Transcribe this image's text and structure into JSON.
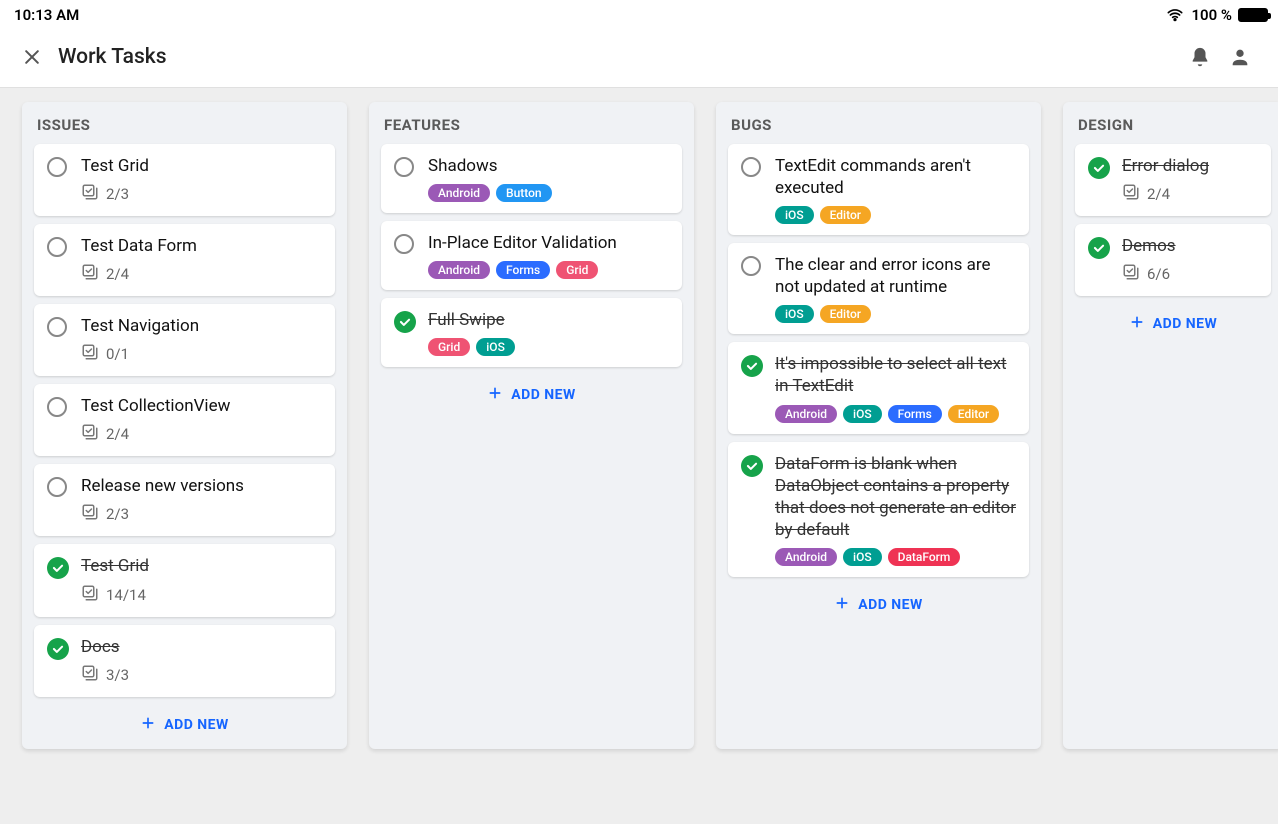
{
  "status": {
    "time": "10:13 AM",
    "battery": "100 %"
  },
  "header": {
    "title": "Work Tasks"
  },
  "ui": {
    "add_new": "ADD NEW"
  },
  "tag_classes": {
    "Android": "t-android",
    "Button": "t-button",
    "Forms": "t-forms",
    "Grid": "t-grid",
    "iOS": "t-ios",
    "Editor": "t-editor",
    "DataForm": "t-dataform"
  },
  "columns": [
    {
      "title": "Issues",
      "cards": [
        {
          "title": "Test Grid",
          "done": false,
          "subtasks": "2/3"
        },
        {
          "title": "Test Data Form",
          "done": false,
          "subtasks": "2/4"
        },
        {
          "title": "Test Navigation",
          "done": false,
          "subtasks": "0/1"
        },
        {
          "title": "Test CollectionView",
          "done": false,
          "subtasks": "2/4"
        },
        {
          "title": "Release new versions",
          "done": false,
          "subtasks": "2/3"
        },
        {
          "title": "Test Grid",
          "done": true,
          "subtasks": "14/14"
        },
        {
          "title": "Docs",
          "done": true,
          "subtasks": "3/3"
        }
      ]
    },
    {
      "title": "Features",
      "cards": [
        {
          "title": "Shadows",
          "done": false,
          "tags": [
            "Android",
            "Button"
          ]
        },
        {
          "title": "In-Place Editor Validation",
          "done": false,
          "tags": [
            "Android",
            "Forms",
            "Grid"
          ]
        },
        {
          "title": "Full Swipe",
          "done": true,
          "tags": [
            "Grid",
            "iOS"
          ]
        }
      ]
    },
    {
      "title": "Bugs",
      "cards": [
        {
          "title": "TextEdit commands aren't executed",
          "done": false,
          "tags": [
            "iOS",
            "Editor"
          ]
        },
        {
          "title": "The clear and error icons are not updated at runtime",
          "done": false,
          "tags": [
            "iOS",
            "Editor"
          ]
        },
        {
          "title": "It's impossible to select all text in TextEdit",
          "done": true,
          "tags": [
            "Android",
            "iOS",
            "Forms",
            "Editor"
          ]
        },
        {
          "title": "DataForm is blank when DataObject contains a property that does not generate an editor by default",
          "done": true,
          "tags": [
            "Android",
            "iOS",
            "DataForm"
          ]
        }
      ]
    },
    {
      "title": "Design",
      "partial": true,
      "cards": [
        {
          "title": "Error dialog",
          "done": true,
          "subtasks": "2/4"
        },
        {
          "title": "Demos",
          "done": true,
          "subtasks": "6/6"
        }
      ]
    }
  ]
}
